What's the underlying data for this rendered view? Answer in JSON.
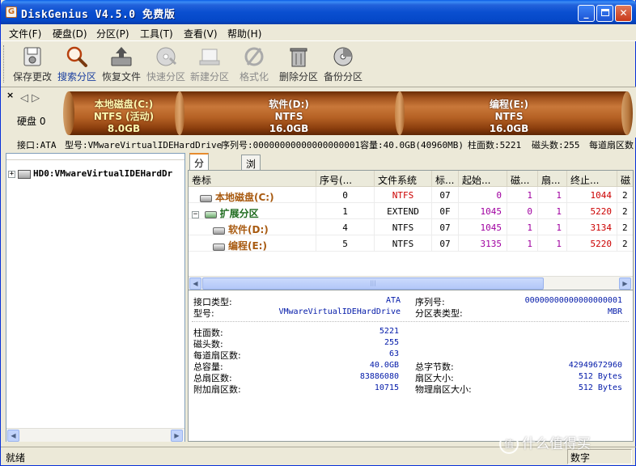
{
  "window": {
    "title": "DiskGenius V4.5.0 免费版",
    "app_icon_letter": "G"
  },
  "menu": [
    "文件(F)",
    "硬盘(D)",
    "分区(P)",
    "工具(T)",
    "查看(V)",
    "帮助(H)"
  ],
  "toolbar": [
    {
      "label": "保存更改",
      "icon": "save-icon",
      "state": "normal"
    },
    {
      "label": "搜索分区",
      "icon": "magnifier-icon",
      "state": "active"
    },
    {
      "label": "恢复文件",
      "icon": "restore-icon",
      "state": "normal"
    },
    {
      "label": "快速分区",
      "icon": "quick-partition-icon",
      "state": "disabled"
    },
    {
      "label": "新建分区",
      "icon": "new-partition-icon",
      "state": "disabled"
    },
    {
      "label": "格式化",
      "icon": "format-icon",
      "state": "disabled"
    },
    {
      "label": "删除分区",
      "icon": "trash-icon",
      "state": "normal"
    },
    {
      "label": "备份分区",
      "icon": "backup-icon",
      "state": "normal"
    }
  ],
  "diskmap": {
    "disk_label": "硬盘 0",
    "partitions": [
      {
        "name": "本地磁盘(C:)",
        "fs": "NTFS (活动)",
        "size": "8.0GB"
      },
      {
        "name": "软件(D:)",
        "fs": "NTFS",
        "size": "16.0GB"
      },
      {
        "name": "编程(E:)",
        "fs": "NTFS",
        "size": "16.0GB"
      }
    ]
  },
  "infobar": {
    "interface": "接口:ATA",
    "model": "型号:VMwareVirtualIDEHardDrive",
    "serial": "序列号:00000000000000000001",
    "capacity": "容量:40.0GB(40960MB)",
    "cylinders": "柱面数:5221",
    "heads": "磁头数:255",
    "sectors": "每道扇区数"
  },
  "tree": {
    "disk_node": "HD0:VMwareVirtualIDEHardDr"
  },
  "tabs": [
    "分区参数",
    "浏览文件"
  ],
  "table": {
    "headers": [
      "卷标",
      "序号(...",
      "文件系统",
      "标...",
      "起始...",
      "磁...",
      "扇...",
      "终止...",
      "磁"
    ],
    "rows": [
      {
        "name": "本地磁盘(C:)",
        "index": "0",
        "fs": "NTFS",
        "id": "07",
        "start_cyl": "0",
        "start_head": "1",
        "start_sec": "1",
        "end_cyl": "1044",
        "end_head": "2"
      },
      {
        "name": "扩展分区",
        "index": "1",
        "fs": "EXTEND",
        "id": "0F",
        "start_cyl": "1045",
        "start_head": "0",
        "start_sec": "1",
        "end_cyl": "5220",
        "end_head": "2"
      },
      {
        "name": "软件(D:)",
        "index": "4",
        "fs": "NTFS",
        "id": "07",
        "start_cyl": "1045",
        "start_head": "1",
        "start_sec": "1",
        "end_cyl": "3134",
        "end_head": "2"
      },
      {
        "name": "编程(E:)",
        "index": "5",
        "fs": "NTFS",
        "id": "07",
        "start_cyl": "3135",
        "start_head": "1",
        "start_sec": "1",
        "end_cyl": "5220",
        "end_head": "2"
      }
    ]
  },
  "details": {
    "interface_type_label": "接口类型:",
    "interface_type": "ATA",
    "serial_label": "序列号:",
    "serial": "00000000000000000001",
    "model_label": "型号:",
    "model": "VMwareVirtualIDEHardDrive",
    "ptable_label": "分区表类型:",
    "ptable": "MBR",
    "cylinders_label": "柱面数:",
    "cylinders": "5221",
    "heads_label": "磁头数:",
    "heads": "255",
    "spt_label": "每道扇区数:",
    "spt": "63",
    "capacity_label": "总容量:",
    "capacity": "40.0GB",
    "total_bytes_label": "总字节数:",
    "total_bytes": "42949672960",
    "total_sectors_label": "总扇区数:",
    "total_sectors": "83886080",
    "sector_size_label": "扇区大小:",
    "sector_size": "512 Bytes",
    "extra_sectors_label": "附加扇区数:",
    "extra_sectors": "10715",
    "phys_sector_label": "物理扇区大小:",
    "phys_sector": "512 Bytes"
  },
  "status": {
    "left": "就绪",
    "right": "数字"
  },
  "watermark": {
    "icon_glyph": "值",
    "text": "什么值得买"
  }
}
